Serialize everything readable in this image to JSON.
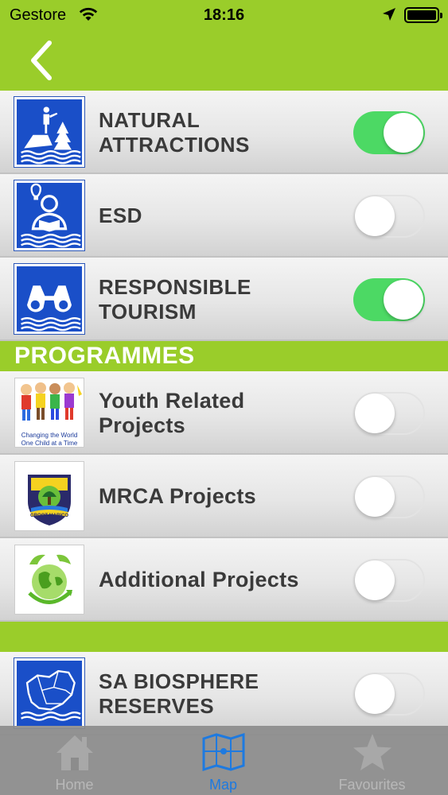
{
  "status_bar": {
    "carrier": "Gestore",
    "time": "18:16"
  },
  "header": {
    "back_icon": "chevron-left-icon"
  },
  "rows_top": [
    {
      "label": "NATURAL ATTRACTIONS",
      "icon": "natural-attractions-icon",
      "toggle_on": true
    },
    {
      "label": "ESD",
      "icon": "esd-icon",
      "toggle_on": false
    },
    {
      "label": "RESPONSIBLE TOURISM",
      "icon": "responsible-tourism-icon",
      "toggle_on": true
    }
  ],
  "section_programmes": {
    "title": "PROGRAMMES"
  },
  "rows_programmes": [
    {
      "label": "Youth Related Projects",
      "icon": "youth-projects-image",
      "toggle_on": false,
      "image_caption_1": "Changing the World",
      "image_caption_2": "One Child at a Time"
    },
    {
      "label": "MRCA Projects",
      "icon": "mrca-logo-image",
      "toggle_on": false,
      "logo_text": "GROOT MARICO"
    },
    {
      "label": "Additional Projects",
      "icon": "green-globe-image",
      "toggle_on": false
    }
  ],
  "rows_bottom": [
    {
      "label": "SA BIOSPHERE RESERVES",
      "icon": "sa-map-icon",
      "toggle_on": false
    }
  ],
  "tabbar": {
    "tabs": [
      {
        "label": "Home",
        "icon": "home-icon",
        "active": false
      },
      {
        "label": "Map",
        "icon": "map-icon",
        "active": true
      },
      {
        "label": "Favourites",
        "icon": "star-icon",
        "active": false
      }
    ]
  },
  "colors": {
    "brand_green": "#9acd2a",
    "toggle_on": "#4cd964",
    "active_tab": "#1e7ae0",
    "inactive_tab": "#b8b8b8"
  }
}
